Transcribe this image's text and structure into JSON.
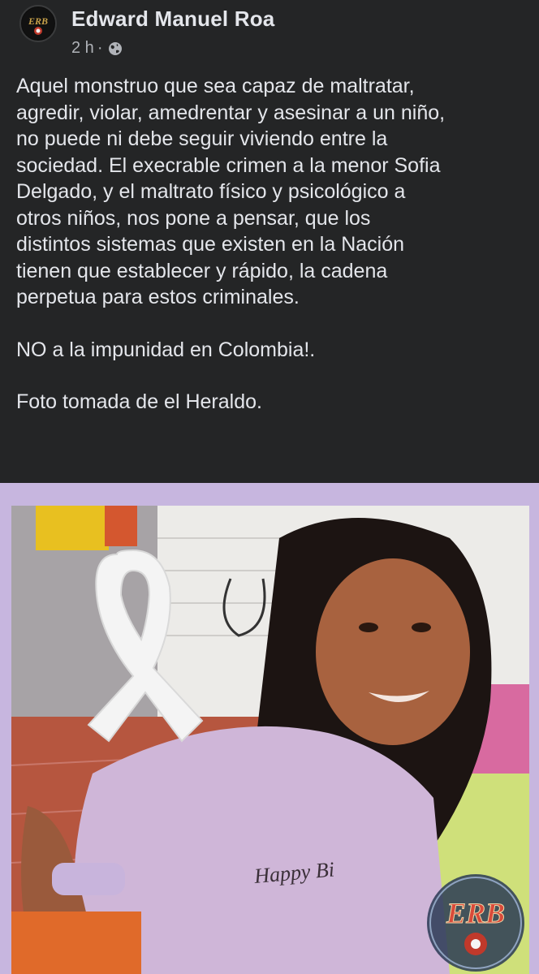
{
  "post": {
    "author": "Edward Manuel Roa",
    "time": "2 h",
    "privacy_icon": "globe-icon",
    "avatar_text": "ERB",
    "paragraphs": [
      "Aquel monstruo que sea capaz de maltratar,\nagredir, violar, amedrentar y asesinar a un niño,\nno puede ni debe seguir viviendo entre la\nsociedad. El execrable crimen  a la menor Sofia\nDelgado,  y el maltrato físico y psicológico a\notros niños,  nos pone a pensar, que los\ndistintos sistemas que existen en la Nación\ntienen que establecer y rápido, la cadena\nperpetua para estos criminales.",
      "NO a la impunidad en Colombia!.",
      "Foto tomada de el Heraldo."
    ],
    "photo": {
      "shirt_text": "Happy Bi",
      "watermark": "ERB"
    }
  },
  "colors": {
    "background": "#242526",
    "text": "#e4e6eb",
    "secondary_text": "#b0b3b8",
    "photo_frame": "#c7b6df"
  }
}
